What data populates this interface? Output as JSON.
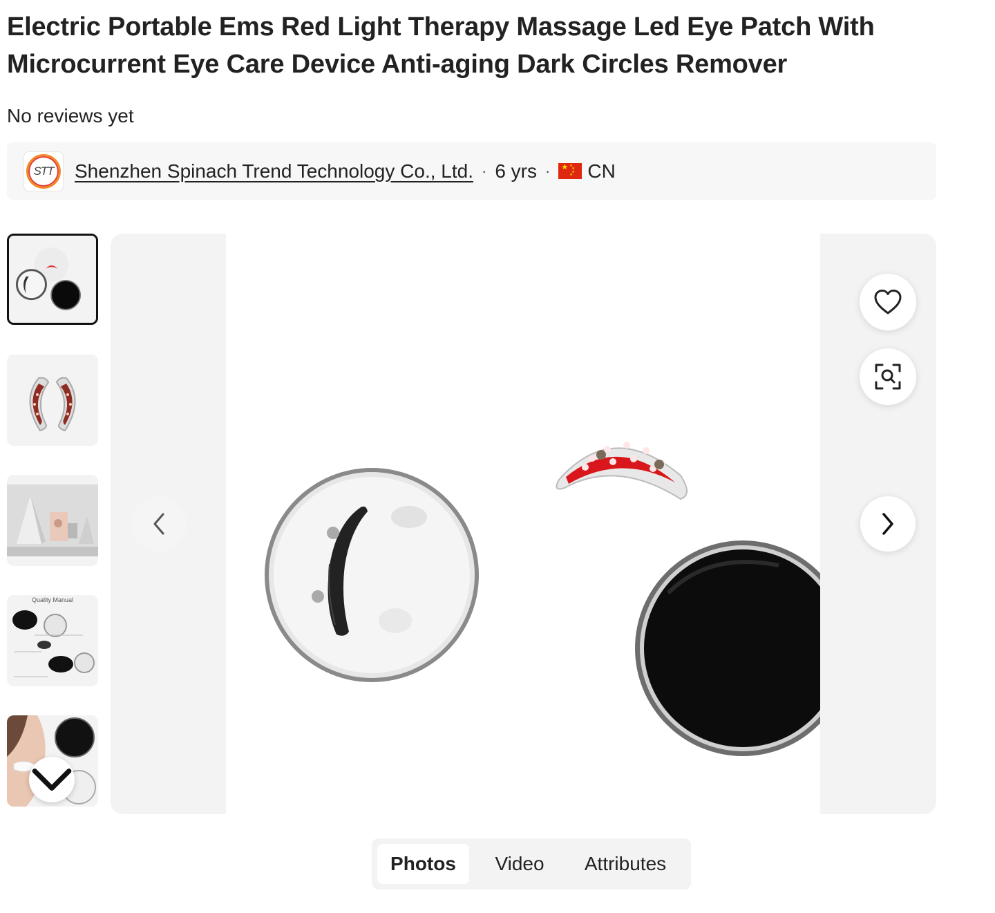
{
  "product": {
    "title": "Electric Portable Ems Red Light Therapy Massage Led Eye Patch With Microcurrent Eye Care Device Anti-aging Dark Circles Remover",
    "reviews": "No reviews yet"
  },
  "supplier": {
    "logo_text": "STT",
    "name": "Shenzhen Spinach Trend Technology Co., Ltd.",
    "years": "6 yrs",
    "country": "CN",
    "separator": "·"
  },
  "gallery": {
    "thumbnails": [
      {
        "label": "thumbnail-1",
        "active": true
      },
      {
        "label": "thumbnail-2",
        "active": false
      },
      {
        "label": "thumbnail-3",
        "active": false
      },
      {
        "label": "thumbnail-4",
        "active": false,
        "text": "Quality Manual"
      },
      {
        "label": "thumbnail-5",
        "active": false
      }
    ],
    "icons": {
      "favorite": "heart-icon",
      "image_search": "image-search-icon",
      "prev": "chevron-left-icon",
      "next": "chevron-right-icon",
      "more": "chevron-down-icon"
    }
  },
  "tabs": [
    {
      "label": "Photos",
      "active": true
    },
    {
      "label": "Video",
      "active": false
    },
    {
      "label": "Attributes",
      "active": false
    }
  ],
  "colors": {
    "accent_red": "#e02020",
    "text": "#222222",
    "panel_bg": "#f3f3f3"
  }
}
